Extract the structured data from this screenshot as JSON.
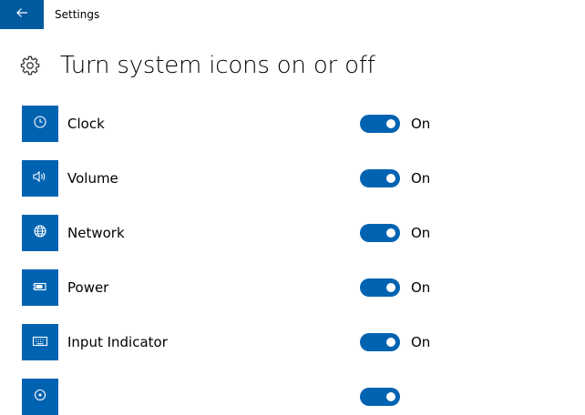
{
  "window": {
    "app_title": "Settings"
  },
  "header": {
    "title": "Turn system icons on or off"
  },
  "colors": {
    "accent": "#0063b1",
    "back_button": "#005a9e"
  },
  "items": [
    {
      "label": "Clock",
      "state": "On",
      "icon": "clock-icon",
      "enabled": true
    },
    {
      "label": "Volume",
      "state": "On",
      "icon": "volume-icon",
      "enabled": true
    },
    {
      "label": "Network",
      "state": "On",
      "icon": "network-icon",
      "enabled": true
    },
    {
      "label": "Power",
      "state": "On",
      "icon": "power-icon",
      "enabled": true
    },
    {
      "label": "Input Indicator",
      "state": "On",
      "icon": "keyboard-icon",
      "enabled": true
    },
    {
      "label": "",
      "state": "",
      "icon": "location-icon",
      "enabled": true
    }
  ]
}
